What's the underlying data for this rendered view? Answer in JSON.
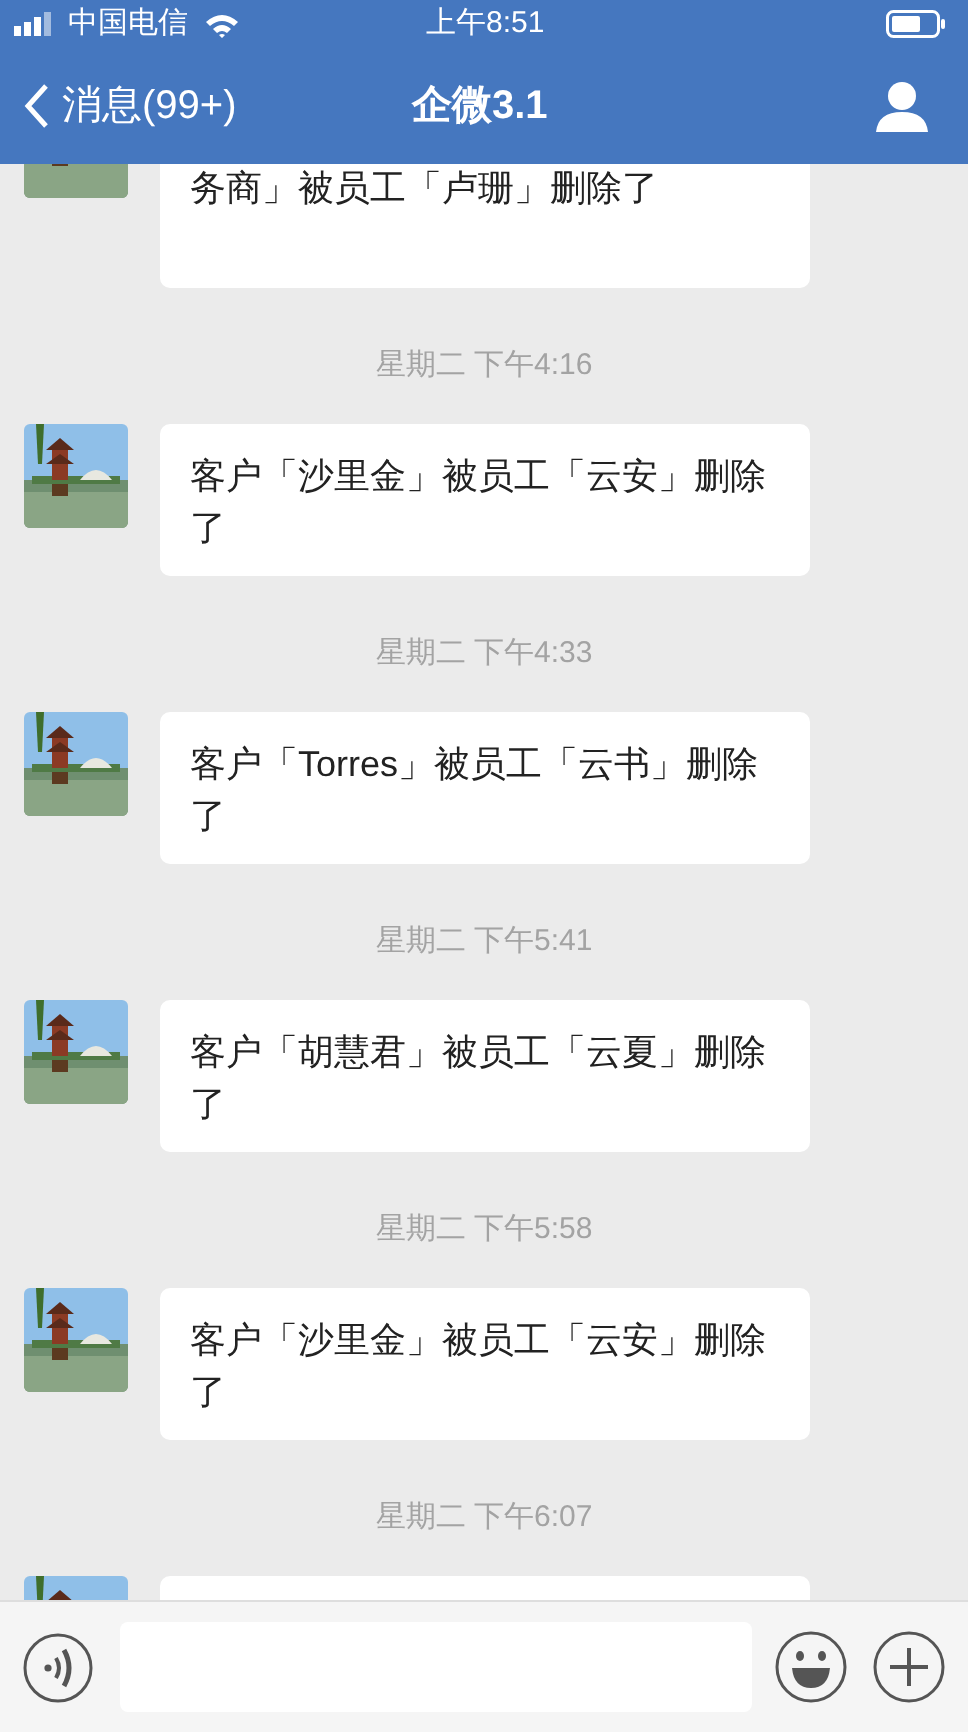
{
  "status_bar": {
    "carrier": "中国电信",
    "time": "上午8:51"
  },
  "nav": {
    "back_label": "消息(99+)",
    "title": "企微3.1"
  },
  "messages": [
    {
      "text": "务商」被员工「卢珊」删除了"
    },
    {
      "time": "星期二 下午4:16",
      "text": "客户「沙里金」被员工「云安」删除了"
    },
    {
      "time": "星期二 下午4:33",
      "text": "客户「Torres」被员工「云书」删除了"
    },
    {
      "time": "星期二 下午5:41",
      "text": "客户「胡慧君」被员工「云夏」删除了"
    },
    {
      "time": "星期二 下午5:58",
      "text": "客户「沙里金」被员工「云安」删除了"
    },
    {
      "time": "星期二 下午6:07"
    }
  ]
}
